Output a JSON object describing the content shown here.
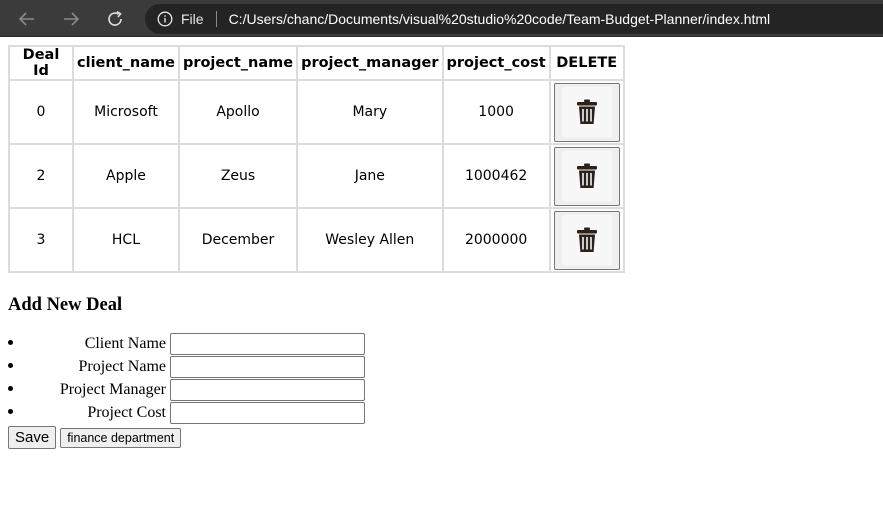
{
  "browser": {
    "file_label": "File",
    "url": "C:/Users/chanc/Documents/visual%20studio%20code/Team-Budget-Planner/index.html"
  },
  "table": {
    "headers": [
      "Deal Id",
      "client_name",
      "project_name",
      "project_manager",
      "project_cost",
      "DELETE"
    ],
    "rows": [
      {
        "deal_id": "0",
        "client_name": "Microsoft",
        "project_name": "Apollo",
        "project_manager": "Mary",
        "project_cost": "1000"
      },
      {
        "deal_id": "2",
        "client_name": "Apple",
        "project_name": "Zeus",
        "project_manager": "Jane",
        "project_cost": "1000462"
      },
      {
        "deal_id": "3",
        "client_name": "HCL",
        "project_name": "December",
        "project_manager": "Wesley Allen",
        "project_cost": "2000000"
      }
    ]
  },
  "form": {
    "title": "Add New Deal",
    "fields": [
      {
        "label": "Client Name",
        "value": ""
      },
      {
        "label": "Project Name",
        "value": ""
      },
      {
        "label": "Project Manager",
        "value": ""
      },
      {
        "label": "Project Cost",
        "value": ""
      }
    ],
    "save_label": "Save",
    "finance_label": "finance department"
  }
}
